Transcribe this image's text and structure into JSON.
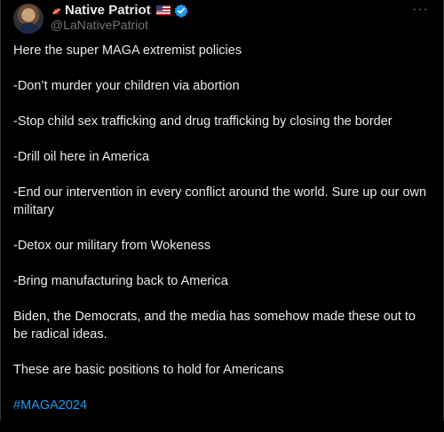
{
  "author": {
    "display_name": "Native Patriot",
    "handle": "@LaNativePatriot"
  },
  "icons": {
    "feather": "feather-icon",
    "flag": "us-flag-icon",
    "verified": "verified-badge-icon",
    "more": "more-options-icon"
  },
  "colors": {
    "background": "#000000",
    "text": "#e7e9ea",
    "muted": "#71767b",
    "link": "#1d9bf0"
  },
  "post": {
    "paragraphs": [
      "Here the super MAGA extremist policies",
      "-Don’t murder your children via abortion",
      "-Stop child sex trafficking and drug trafficking by closing the border",
      "-Drill oil here in America",
      "-End our intervention in every conflict around the world. Sure up our own military",
      "-Detox our military from Wokeness",
      "-Bring manufacturing back to America",
      "Biden, the Democrats, and the media has somehow made these out to be radical ideas.",
      "These are basic positions to hold for Americans"
    ],
    "hashtag": "#MAGA2024"
  }
}
